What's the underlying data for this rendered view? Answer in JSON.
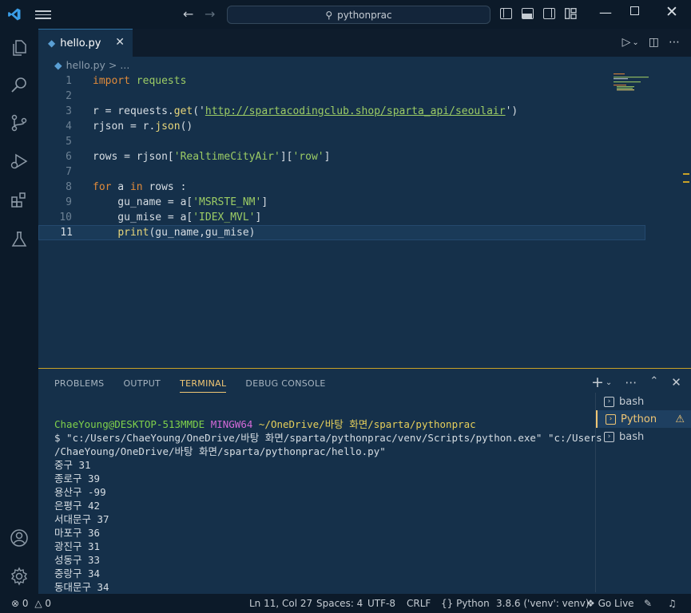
{
  "titlebar": {
    "search_text": "pythonprac",
    "icons": [
      "vscode-logo",
      "menu-icon",
      "back-arrow-icon",
      "forward-arrow-icon",
      "toggle-primary-sidebar-icon",
      "toggle-panel-icon",
      "toggle-secondary-sidebar-icon",
      "customize-layout-icon",
      "minimize-icon",
      "maximize-icon",
      "close-icon"
    ]
  },
  "activitybar": {
    "items": [
      "explorer-icon",
      "search-icon",
      "source-control-icon",
      "run-debug-icon",
      "extensions-icon",
      "testing-icon"
    ],
    "bottom": [
      "accounts-icon",
      "settings-gear-icon"
    ]
  },
  "editor": {
    "tab_label": "hello.py",
    "breadcrumb_file": "hello.py",
    "breadcrumb_rest": "> ...",
    "active_line": 11,
    "line_numbers": [
      "1",
      "2",
      "3",
      "4",
      "5",
      "6",
      "7",
      "8",
      "9",
      "10",
      "11"
    ],
    "code": {
      "l1_kw": "import",
      "l1_mod": " requests",
      "l3_a": "r = requests.",
      "l3_fn": "get",
      "l3_b": "('",
      "l3_url": "http://spartacodingclub.shop/sparta_api/seoulair",
      "l3_c": "')",
      "l4_a": "rjson = r.",
      "l4_fn": "json",
      "l4_b": "()",
      "l6_a": "rows = rjson[",
      "l6_s1": "'RealtimeCityAir'",
      "l6_b": "][",
      "l6_s2": "'row'",
      "l6_c": "]",
      "l8_kw1": "for",
      "l8_a": " a ",
      "l8_kw2": "in",
      "l8_b": " rows :",
      "l9_a": "    gu_name = a[",
      "l9_s": "'MSRSTE_NM'",
      "l9_b": "]",
      "l10_a": "    gu_mise = a[",
      "l10_s": "'IDEX_MVL'",
      "l10_b": "]",
      "l11_a": "    ",
      "l11_fn": "print",
      "l11_b": "(gu_name,gu_mise)"
    }
  },
  "panel": {
    "tabs": [
      "PROBLEMS",
      "OUTPUT",
      "TERMINAL",
      "DEBUG CONSOLE"
    ],
    "active_tab": "TERMINAL",
    "terminal": {
      "prompt_user": "ChaeYoung@DESKTOP-513MMDE",
      "prompt_env": "MINGW64",
      "prompt_path": "~/OneDrive/바탕 화면/sparta/pythonprac",
      "command_line1": "$ \"c:/Users/ChaeYoung/OneDrive/바탕 화면/sparta/pythonprac/venv/Scripts/python.exe\" \"c:/Users",
      "command_line2": "/ChaeYoung/OneDrive/바탕 화면/sparta/pythonprac/hello.py\"",
      "output": [
        "중구 31",
        "종로구 39",
        "용산구 -99",
        "은평구 42",
        "서대문구 37",
        "마포구 36",
        "광진구 31",
        "성동구 33",
        "중랑구 34",
        "동대문구 34"
      ]
    },
    "terminal_list": [
      {
        "label": "bash",
        "active": false
      },
      {
        "label": "Python",
        "active": true,
        "warning": true
      },
      {
        "label": "bash",
        "active": false
      }
    ]
  },
  "statusbar": {
    "errors": "0",
    "warnings": "0",
    "position": "Ln 11, Col 27",
    "spaces": "Spaces: 4",
    "encoding": "UTF-8",
    "eol": "CRLF",
    "language": "Python",
    "interpreter": "3.8.6 ('venv': venv)",
    "golive": "Go Live"
  },
  "colors": {
    "editor_bg": "#15304a",
    "chrome_bg": "#0c1a29",
    "accent": "#f0c674",
    "keyword": "#e08a3a",
    "string": "#9ccc65"
  }
}
